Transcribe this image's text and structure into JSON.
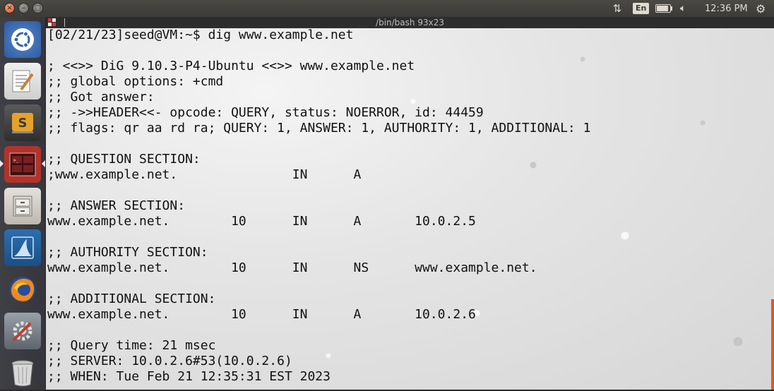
{
  "topbar": {
    "window_controls": [
      "×",
      "–",
      "□"
    ],
    "network_icon": "network-updown-icon",
    "keyboard_layout": "En",
    "battery_level": 0.9,
    "volume_icon": "speaker-icon",
    "time": "12:36 PM",
    "settings_icon": "gear-icon"
  },
  "launcher": {
    "items": [
      {
        "name": "ubuntu-dash",
        "icon": "ubuntu-logo-icon"
      },
      {
        "name": "text-editor",
        "icon": "text-editor-icon"
      },
      {
        "name": "sublime-text",
        "icon": "sublime-text-icon"
      },
      {
        "name": "terminal",
        "icon": "terminal-icon",
        "active": true
      },
      {
        "name": "files",
        "icon": "file-cabinet-icon"
      },
      {
        "name": "wireshark",
        "icon": "wireshark-fin-icon"
      },
      {
        "name": "firefox",
        "icon": "firefox-icon"
      },
      {
        "name": "system-settings",
        "icon": "settings-tools-icon"
      },
      {
        "name": "trash",
        "icon": "trash-icon"
      }
    ]
  },
  "terminal": {
    "title": "/bin/bash 93x23",
    "lines": [
      "[02/21/23]seed@VM:~$ dig www.example.net",
      "",
      "; <<>> DiG 9.10.3-P4-Ubuntu <<>> www.example.net",
      ";; global options: +cmd",
      ";; Got answer:",
      ";; ->>HEADER<<- opcode: QUERY, status: NOERROR, id: 44459",
      ";; flags: qr aa rd ra; QUERY: 1, ANSWER: 1, AUTHORITY: 1, ADDITIONAL: 1",
      "",
      ";; QUESTION SECTION:",
      ";www.example.net.               IN      A",
      "",
      ";; ANSWER SECTION:",
      "www.example.net.        10      IN      A       10.0.2.5",
      "",
      ";; AUTHORITY SECTION:",
      "www.example.net.        10      IN      NS      www.example.net.",
      "",
      ";; ADDITIONAL SECTION:",
      "www.example.net.        10      IN      A       10.0.2.6",
      "",
      ";; Query time: 21 msec",
      ";; SERVER: 10.0.2.6#53(10.0.2.6)",
      ";; WHEN: Tue Feb 21 12:35:31 EST 2023"
    ]
  }
}
